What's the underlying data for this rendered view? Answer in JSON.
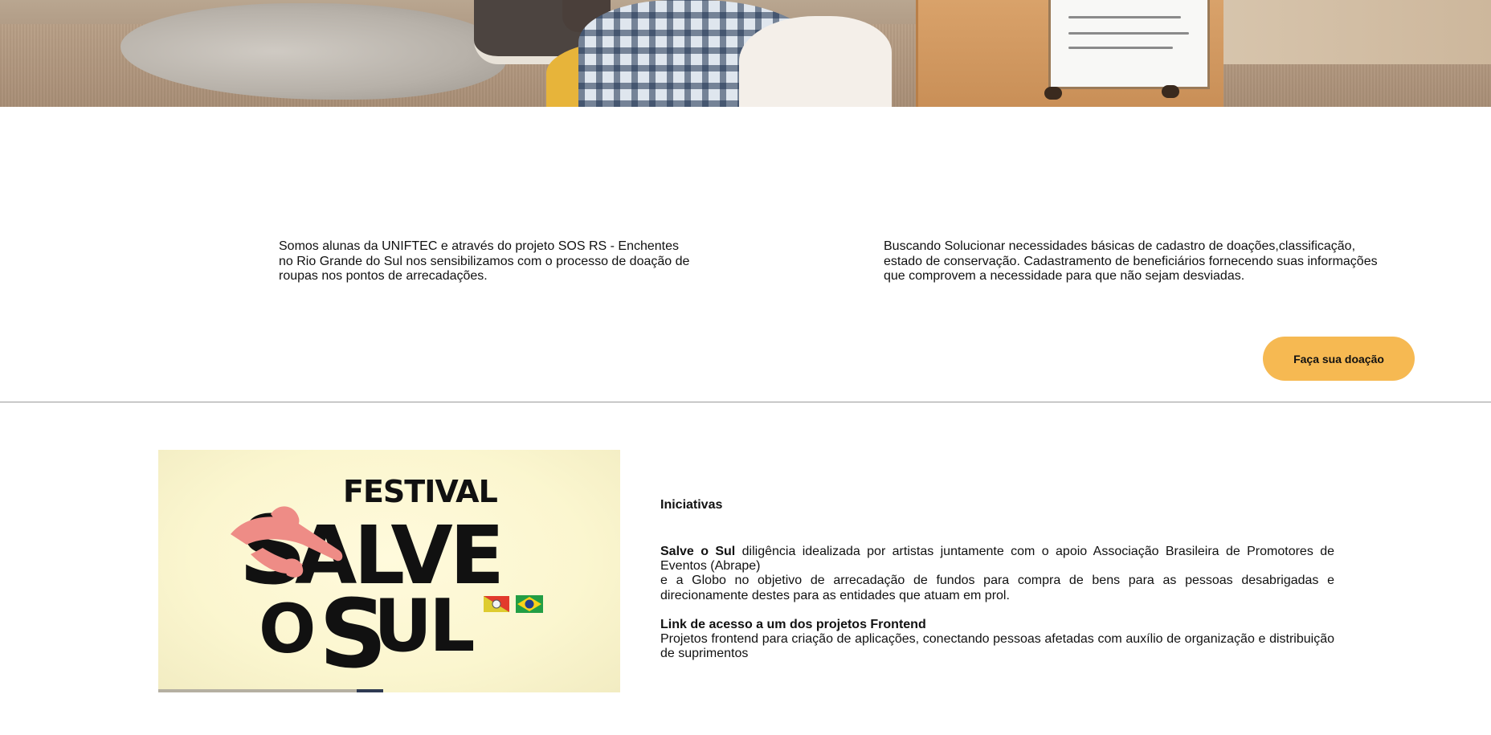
{
  "hero": {
    "image_name": "donated-clothes-photo"
  },
  "info": {
    "left_text": "Somos alunas da UNIFTEC e através do projeto SOS RS - Enchentes no Rio Grande do Sul nos sensibilizamos com o processo de doação de roupas nos pontos de arrecadações.",
    "right_text": "Buscando Solucionar necessidades básicas de cadastro de doações,classificação, estado de conservação. Cadastramento de beneficiários fornecendo suas informações que comprovem a necessidade para que não sejam desviadas."
  },
  "donate_button": {
    "label": "Faça sua doação",
    "color": "#f6b952"
  },
  "festival_image": {
    "line1": "FESTIVAL",
    "line2": "SALVE",
    "line3": "O SUL",
    "carousel_progress": 0.49,
    "colors": {
      "background": "#fbf6cf",
      "text": "#111111",
      "hands": "#ee8c86"
    }
  },
  "initiatives": {
    "title": "Iniciativas",
    "salve_bold": "Salve o Sul",
    "salve_rest": " diligência idealizada por artistas juntamente com o apoio Associação Brasileira de Promotores de Eventos (Abrape)",
    "globo_text": "e a Globo no objetivo de arrecadação de fundos para compra de bens para as pessoas desabrigadas e direcionamente destes para as entidades que atuam em prol.",
    "link_title": "Link de acesso a um dos projetos Frontend",
    "link_text": "Projetos frontend para criação de aplicações, conectando pessoas afetadas com auxílio de organização e distribuição de suprimentos"
  }
}
